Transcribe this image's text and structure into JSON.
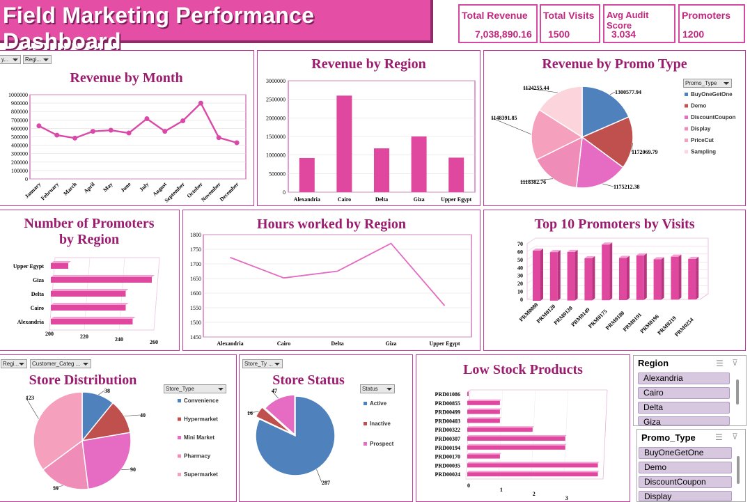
{
  "header": {
    "title": "Field Marketing Performance Dashboard"
  },
  "kpis": [
    {
      "label": "Total Revenue",
      "value": "7,038,890.16"
    },
    {
      "label": "Total Visits",
      "value": "1500"
    },
    {
      "label": "Avg Audit Score",
      "value": "3.034"
    },
    {
      "label": "Promoters",
      "value": "1200"
    }
  ],
  "filters": {
    "month_filter_1": "y...",
    "month_filter_2": "Regi...",
    "store_dist_filter_1": "Regi...",
    "store_dist_filter_2": "Customer_Categ ...",
    "store_status_filter": "Store_Ty ..."
  },
  "colors": {
    "accent": "#e44fa5",
    "title": "#9b1c6e",
    "bar": "#e0489f",
    "blue": "#4f81bd",
    "red": "#c0504d"
  },
  "revenue_by_month": {
    "title": "Revenue by Month",
    "chart_data": {
      "type": "line",
      "categories": [
        "January",
        "February",
        "March",
        "April",
        "May",
        "June",
        "July",
        "August",
        "September",
        "October",
        "November",
        "December"
      ],
      "values": [
        630000,
        520000,
        485000,
        565000,
        578000,
        545000,
        715000,
        565000,
        690000,
        900000,
        490000,
        430000
      ],
      "ylim": [
        0,
        1000000
      ],
      "yticks": [
        "0",
        "100000",
        "200000",
        "300000",
        "400000",
        "500000",
        "600000",
        "700000",
        "800000",
        "900000",
        "1000000"
      ]
    }
  },
  "revenue_by_region": {
    "title": "Revenue by Region",
    "chart_data": {
      "type": "bar",
      "categories": [
        "Alexandria",
        "Cairo",
        "Delta",
        "Giza",
        "Upper Egypt"
      ],
      "values": [
        920000,
        2600000,
        1180000,
        1500000,
        930000
      ],
      "ylim": [
        0,
        3000000
      ],
      "yticks": [
        "0",
        "500000",
        "1000000",
        "1500000",
        "2000000",
        "2500000",
        "3000000"
      ]
    }
  },
  "revenue_by_promo": {
    "title": "Revenue by Promo Type",
    "filter_label": "Promo_Type",
    "chart_data": {
      "type": "pie",
      "labels": [
        "BuyOneGetOne",
        "Demo",
        "DiscountCoupon",
        "Display",
        "PriceCut",
        "Sampling"
      ],
      "values": [
        1300577.94,
        1172069.79,
        1175212.38,
        1118382.76,
        1148391.85,
        1124255.44
      ],
      "data_labels": [
        "1300577.94",
        "1172069.79",
        "1175212.38",
        "1118382.76",
        "1148391.85",
        "1124255.44"
      ],
      "colors": [
        "#4f81bd",
        "#c0504d",
        "#e66bc2",
        "#f08cb8",
        "#f5a0bc",
        "#fcd5dc"
      ]
    }
  },
  "promoters_by_region": {
    "title_line1": "Number of Promoters",
    "title_line2": "by Region",
    "chart_data": {
      "type": "bar",
      "categories": [
        "Upper Egypt",
        "Giza",
        "Delta",
        "Cairo",
        "Alexandria"
      ],
      "values": [
        210,
        258,
        243,
        243,
        247
      ],
      "xlim": [
        200,
        260
      ],
      "xticks": [
        "200",
        "220",
        "240",
        "260"
      ]
    }
  },
  "hours_by_region": {
    "title": "Hours worked by Region",
    "chart_data": {
      "type": "line",
      "categories": [
        "Alexandria",
        "Cairo",
        "Delta",
        "Giza",
        "Upper Egypt"
      ],
      "values": [
        1722,
        1652,
        1675,
        1770,
        1557
      ],
      "ylim": [
        1450,
        1800
      ],
      "yticks": [
        "1450",
        "1500",
        "1550",
        "1600",
        "1650",
        "1700",
        "1750",
        "1800"
      ]
    }
  },
  "top_promoters": {
    "title": "Top 10 Promoters by Visits",
    "chart_data": {
      "type": "bar",
      "categories": [
        "PRM0080",
        "PRM0120",
        "PRM0130",
        "PRM0149",
        "PRM0175",
        "PRM0180",
        "PRM0191",
        "PRM0196",
        "PRM0219",
        "PRM0254"
      ],
      "values": [
        56,
        54,
        54,
        46,
        63,
        46,
        49,
        44,
        47,
        44
      ],
      "ylim": [
        0,
        70
      ],
      "yticks": [
        "0",
        "10",
        "20",
        "30",
        "40",
        "50",
        "60",
        "70"
      ]
    }
  },
  "store_distribution": {
    "title": "Store Distribution",
    "filter_label": "Store_Type",
    "chart_data": {
      "type": "pie",
      "labels": [
        "Convenience",
        "Hypermarket",
        "Mini Market",
        "Pharmacy",
        "Supermarket"
      ],
      "values": [
        38,
        40,
        90,
        59,
        123
      ],
      "data_labels": [
        "38",
        "40",
        "90",
        "59",
        "123"
      ],
      "colors": [
        "#4f81bd",
        "#c0504d",
        "#e66bc2",
        "#f08cb8",
        "#f5a0bc"
      ]
    }
  },
  "store_status": {
    "title": "Store Status",
    "filter_label": "Status",
    "chart_data": {
      "type": "pie",
      "labels": [
        "Active",
        "Inactive",
        "Prospect"
      ],
      "values": [
        287,
        16,
        47
      ],
      "data_labels": [
        "287",
        "16",
        "47"
      ],
      "colors": [
        "#4f81bd",
        "#c0504d",
        "#e66bc2"
      ]
    }
  },
  "low_stock": {
    "title": "Low Stock Products",
    "chart_data": {
      "type": "bar",
      "categories": [
        "PRD01086",
        "PRD00855",
        "PRD00499",
        "PRD00403",
        "PRD00322",
        "PRD00307",
        "PRD00194",
        "PRD00170",
        "PRD00035",
        "PRD00024"
      ],
      "values": [
        0,
        1,
        1,
        1,
        2,
        3,
        3,
        1,
        4,
        4
      ],
      "xticks": [
        "0",
        "1",
        "2",
        "3"
      ]
    }
  },
  "slicer_region": {
    "header": "Region",
    "items": [
      "Alexandria",
      "Cairo",
      "Delta",
      "Giza"
    ]
  },
  "slicer_promo": {
    "header": "Promo_Type",
    "items": [
      "BuyOneGetOne",
      "Demo",
      "DiscountCoupon",
      "Display"
    ]
  }
}
